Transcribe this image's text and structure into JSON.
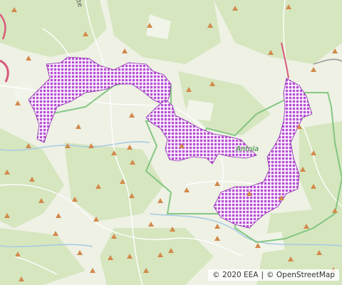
{
  "map": {
    "place_label": "Antola",
    "town_label": "nte"
  },
  "attribution": {
    "eea": "© 2020 EEA",
    "separator": "|",
    "osm": "© OpenStreetMap"
  },
  "colors": {
    "background": "#f2efe9",
    "forest": "#dbe8c6",
    "meadow": "#e9f2e0",
    "park_border": "#7ac27a",
    "protected_area_fill": "#b84fd6",
    "protected_area_grid": "#ffffff",
    "peak_marker": "#d2894b",
    "road": "#ffffff",
    "highway": "#d85a7a",
    "river": "#9ec3df"
  },
  "icons": {
    "peak": "peak-triangle-icon"
  }
}
